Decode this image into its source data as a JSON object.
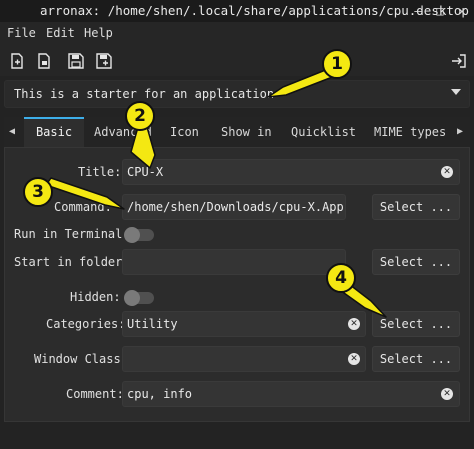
{
  "window": {
    "title": "arronax: /home/shen/.local/share/applications/cpu.desktop",
    "controls": [
      "minimize-icon",
      "maximize-icon",
      "close-icon"
    ]
  },
  "menu": [
    "File",
    "Edit",
    "Help"
  ],
  "toolbar": {
    "icons": [
      "new-file-icon",
      "new-from-template-icon",
      "save-icon",
      "save-as-icon",
      "exit-icon"
    ]
  },
  "description": {
    "value": "This is a starter for an application"
  },
  "tabs": [
    "Basic",
    "Advanced",
    "Icon",
    "Show in",
    "Quicklist",
    "MIME types"
  ],
  "active_tab": "Basic",
  "form": {
    "title": {
      "label": "Title:",
      "value": "CPU-X"
    },
    "command": {
      "label": "Command:",
      "value": "/home/shen/Downloads/cpu-X.AppImage",
      "button": "Select ..."
    },
    "run_in_terminal": {
      "label": "Run in Terminal:",
      "on": false
    },
    "start_in_folder": {
      "label": "Start in folder:",
      "value": "",
      "button": "Select ..."
    },
    "hidden": {
      "label": "Hidden:",
      "on": false
    },
    "categories": {
      "label": "Categories:",
      "value": "Utility",
      "button": "Select ..."
    },
    "window_class": {
      "label": "Window Class:",
      "value": "",
      "button": "Select ..."
    },
    "comment": {
      "label": "Comment:",
      "value": "cpu, info"
    }
  },
  "annotations": [
    "1",
    "2",
    "3",
    "4"
  ],
  "colors": {
    "accent": "#3daee9",
    "annotation": "#f4e812",
    "background": "#2c2c2c"
  }
}
